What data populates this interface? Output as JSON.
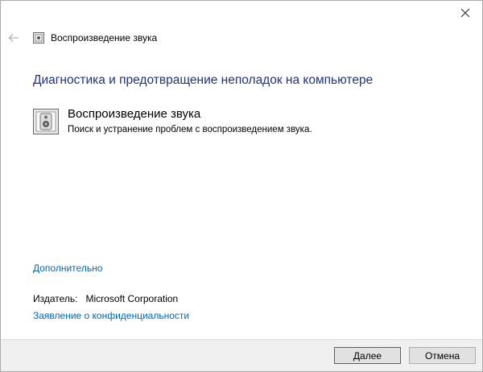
{
  "window": {
    "close_icon": "close-icon"
  },
  "topbar": {
    "back_icon": "back-arrow-icon",
    "title": "Воспроизведение звука"
  },
  "main": {
    "heading": "Диагностика и предотвращение неполадок на компьютере",
    "task": {
      "icon": "speaker-icon",
      "title": "Воспроизведение звука",
      "description": "Поиск и устранение проблем с воспроизведением звука."
    },
    "advanced_link": "Дополнительно",
    "publisher_label": "Издатель:",
    "publisher_value": "Microsoft Corporation",
    "privacy_link": "Заявление о конфиденциальности"
  },
  "footer": {
    "next_label": "Далее",
    "cancel_label": "Отмена"
  },
  "colors": {
    "heading": "#1e3287",
    "link": "#0066cc",
    "footer_bg": "#f0f0f0",
    "primary_border": "#0078d7"
  }
}
